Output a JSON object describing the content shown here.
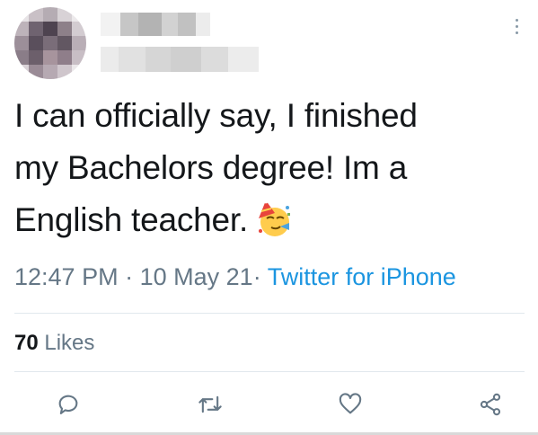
{
  "tweet": {
    "text_lines": [
      "I can officially say, I finished",
      "my Bachelors degree! Im a",
      "English teacher."
    ],
    "emoji_icon": "partying-face-icon",
    "time": "12:47 PM",
    "date": "10 May 21",
    "separator": "·",
    "source": "Twitter for iPhone",
    "likes_count": "70",
    "likes_label": "Likes"
  },
  "actions": [
    {
      "name": "reply-icon"
    },
    {
      "name": "retweet-icon"
    },
    {
      "name": "like-icon"
    },
    {
      "name": "share-icon"
    }
  ],
  "colors": {
    "text": "#14171a",
    "muted": "#657786",
    "link": "#1b95e0",
    "divider": "#e1e8ed",
    "icon": "#657786"
  }
}
